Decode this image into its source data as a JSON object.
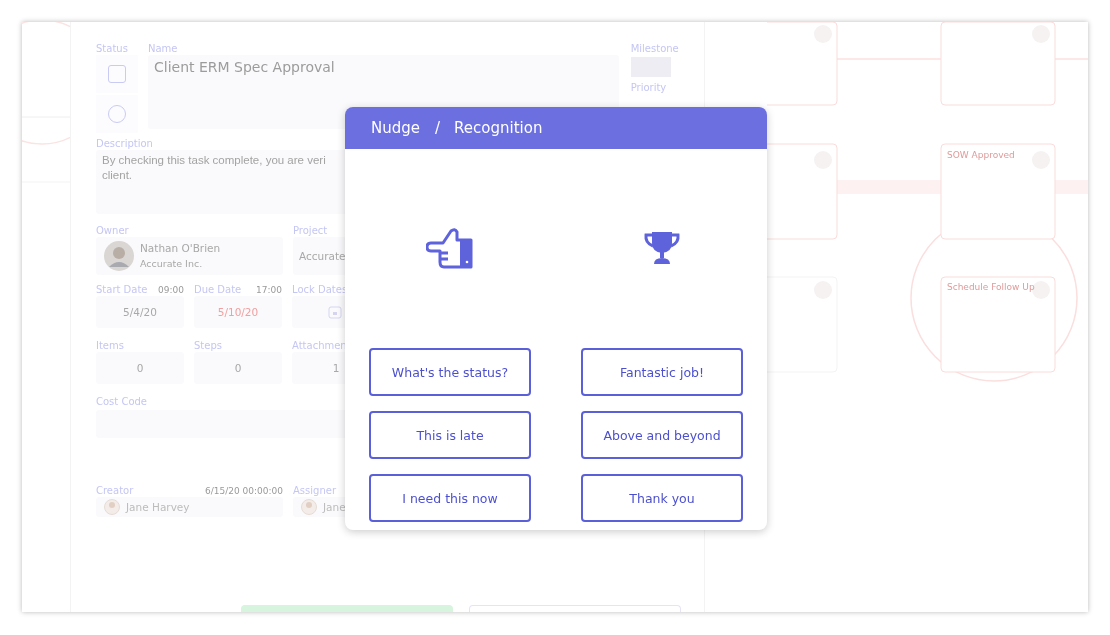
{
  "task_form": {
    "status_label": "Status",
    "status_checked": false,
    "status_radio_selected": false,
    "name_label": "Name",
    "name_value": "Client ERM Spec Approval",
    "milestone_label": "Milestone",
    "priority_label": "Priority",
    "description_label": "Description",
    "description_lines": [
      "By checking this task complete, you are veri",
      "client."
    ],
    "owner_label": "Owner",
    "owner_name": "Nathan O'Brien",
    "owner_company": "Accurate Inc.",
    "project_label": "Project",
    "project_value": "Accurate",
    "dates": [
      {
        "label": "Start Date",
        "time": "09:00",
        "value": "5/4/20",
        "overdue": false
      },
      {
        "label": "Due Date",
        "time": "17:00",
        "value": "5/10/20",
        "overdue": true
      }
    ],
    "lock_dates_label": "Lock Dates",
    "counts": [
      {
        "label": "Items",
        "value": "0"
      },
      {
        "label": "Steps",
        "value": "0"
      },
      {
        "label": "Attachmen",
        "value": "1"
      }
    ],
    "cost_code_label": "Cost Code",
    "creator_label": "Creator",
    "creator_time": "6/15/20 00:00:00",
    "creator_name": "Jane Harvey",
    "assigner_label": "Assigner",
    "assigner_name": "Jane"
  },
  "workflow": {
    "cards": [
      {
        "title": "SOW Approved"
      },
      {
        "title": "Schedule Follow Up"
      }
    ]
  },
  "dialog": {
    "tabs": [
      {
        "label": "Nudge",
        "selected": true
      },
      {
        "label": "Recognition",
        "selected": true
      }
    ],
    "separator": "/",
    "columns": [
      {
        "kind": "nudge",
        "options": [
          "What's the status?",
          "This is late",
          "I need this now"
        ]
      },
      {
        "kind": "recognition",
        "options": [
          "Fantastic job!",
          "Above and beyond",
          "Thank you"
        ]
      }
    ]
  }
}
